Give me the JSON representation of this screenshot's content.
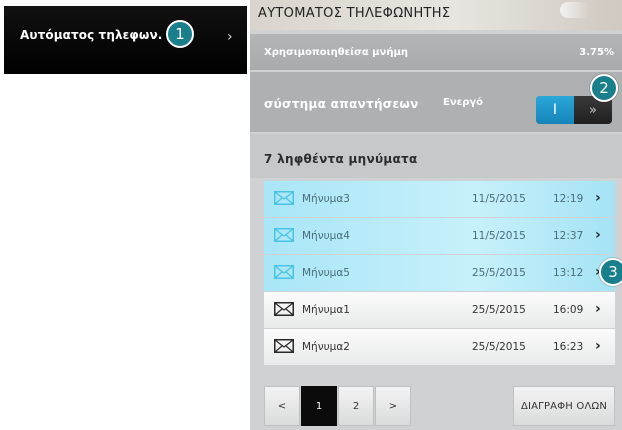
{
  "nav": {
    "label": "Αυτόματος τηλεφων.",
    "arrow": "›"
  },
  "header": {
    "title": "ΑΥΤΟΜΑΤΟΣ ΤΗΛΕΦΩΝΗΤΗΣ"
  },
  "memory": {
    "label": "Χρησιμοποιηθείσα μνήμη",
    "value": "3.75%"
  },
  "answering": {
    "label": "σύστημα απαντήσεων",
    "status": "Ενεργό",
    "toggle_on": "I",
    "toggle_off": "»"
  },
  "messages": {
    "heading": "7 ληφθέντα μηνύματα",
    "items": [
      {
        "name": "Μήνυμα3",
        "date": "11/5/2015",
        "time": "12:19",
        "state": "unread"
      },
      {
        "name": "Μήνυμα4",
        "date": "11/5/2015",
        "time": "12:37",
        "state": "unread"
      },
      {
        "name": "Μήνυμα5",
        "date": "25/5/2015",
        "time": "13:12",
        "state": "unread"
      },
      {
        "name": "Μήνυμα1",
        "date": "25/5/2015",
        "time": "16:09",
        "state": "read"
      },
      {
        "name": "Μήνυμα2",
        "date": "25/5/2015",
        "time": "16:23",
        "state": "read"
      }
    ],
    "chevron": "›"
  },
  "pager": {
    "prev": "<",
    "pages": [
      "1",
      "2"
    ],
    "current": "1",
    "next": ">"
  },
  "actions": {
    "delete_all": "ΔΙΑΓΡΑΦΗ ΟΛΩΝ"
  },
  "callouts": [
    "1",
    "2",
    "3"
  ],
  "colors": {
    "unread_bg": "#a9e6f7",
    "accent_blue": "#1684b8",
    "callout": "#1a7f8c",
    "unread_icon": "#49c3e6"
  },
  "icons": {
    "message_unread": "envelope-icon",
    "message_read": "envelope-icon",
    "toggle_arrows": "double-chevron-icon"
  }
}
